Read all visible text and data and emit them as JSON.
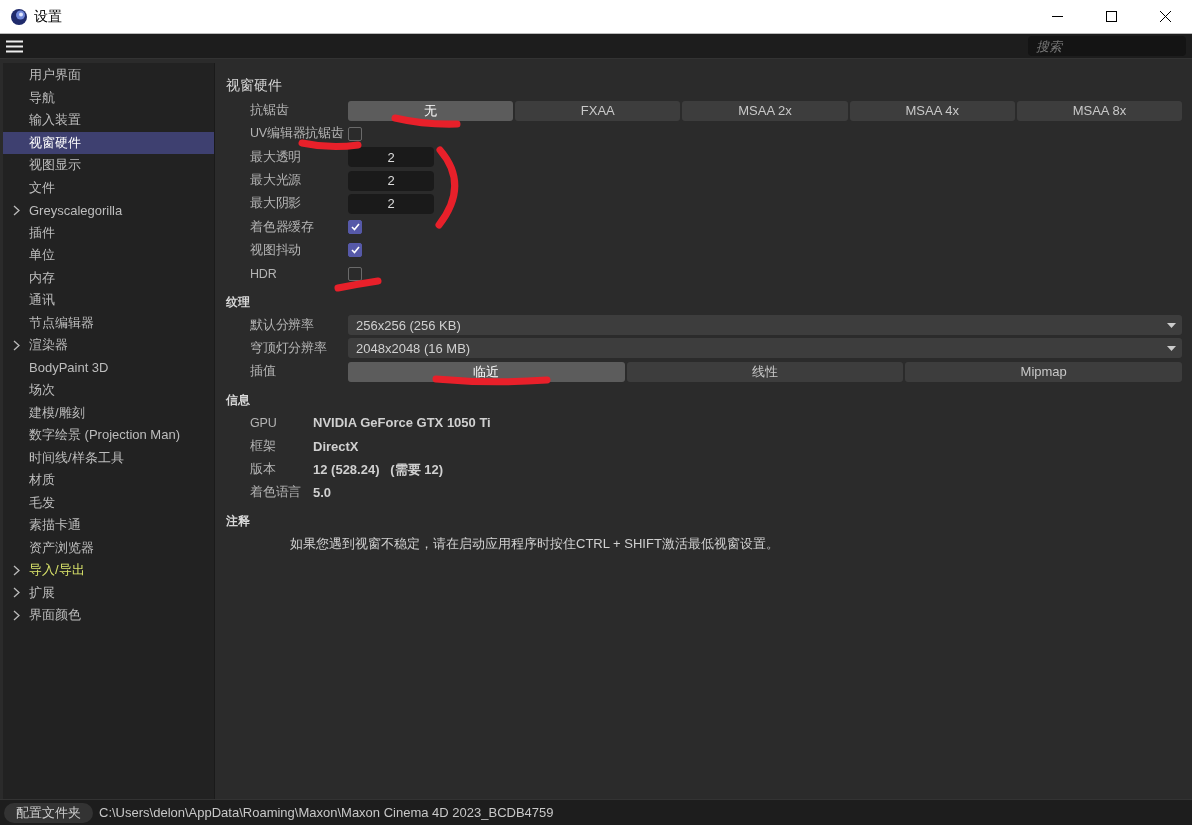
{
  "window": {
    "title": "设置"
  },
  "search": {
    "placeholder": "搜索"
  },
  "sidebar": {
    "items": [
      {
        "label": "用户界面",
        "expandable": false,
        "selected": false,
        "highlighted": false
      },
      {
        "label": "导航",
        "expandable": false,
        "selected": false,
        "highlighted": false
      },
      {
        "label": "输入装置",
        "expandable": false,
        "selected": false,
        "highlighted": false
      },
      {
        "label": "视窗硬件",
        "expandable": false,
        "selected": true,
        "highlighted": false
      },
      {
        "label": "视图显示",
        "expandable": false,
        "selected": false,
        "highlighted": false
      },
      {
        "label": "文件",
        "expandable": false,
        "selected": false,
        "highlighted": false
      },
      {
        "label": "Greyscalegorilla",
        "expandable": true,
        "selected": false,
        "highlighted": false
      },
      {
        "label": "插件",
        "expandable": false,
        "selected": false,
        "highlighted": false
      },
      {
        "label": "单位",
        "expandable": false,
        "selected": false,
        "highlighted": false
      },
      {
        "label": "内存",
        "expandable": false,
        "selected": false,
        "highlighted": false
      },
      {
        "label": "通讯",
        "expandable": false,
        "selected": false,
        "highlighted": false
      },
      {
        "label": "节点编辑器",
        "expandable": false,
        "selected": false,
        "highlighted": false
      },
      {
        "label": "渲染器",
        "expandable": true,
        "selected": false,
        "highlighted": false
      },
      {
        "label": "BodyPaint 3D",
        "expandable": false,
        "selected": false,
        "highlighted": false
      },
      {
        "label": "场次",
        "expandable": false,
        "selected": false,
        "highlighted": false
      },
      {
        "label": "建模/雕刻",
        "expandable": false,
        "selected": false,
        "highlighted": false
      },
      {
        "label": "数字绘景 (Projection Man)",
        "expandable": false,
        "selected": false,
        "highlighted": false
      },
      {
        "label": "时间线/样条工具",
        "expandable": false,
        "selected": false,
        "highlighted": false
      },
      {
        "label": "材质",
        "expandable": false,
        "selected": false,
        "highlighted": false
      },
      {
        "label": "毛发",
        "expandable": false,
        "selected": false,
        "highlighted": false
      },
      {
        "label": "素描卡通",
        "expandable": false,
        "selected": false,
        "highlighted": false
      },
      {
        "label": "资产浏览器",
        "expandable": false,
        "selected": false,
        "highlighted": false
      },
      {
        "label": "导入/导出",
        "expandable": true,
        "selected": false,
        "highlighted": true
      },
      {
        "label": "扩展",
        "expandable": true,
        "selected": false,
        "highlighted": false
      },
      {
        "label": "界面颜色",
        "expandable": true,
        "selected": false,
        "highlighted": false
      }
    ]
  },
  "sections": [
    {
      "title": "视窗硬件",
      "rows": [
        {
          "kind": "segmented",
          "label": "抗锯齿",
          "options": [
            {
              "label": "无",
              "selected": true
            },
            {
              "label": "FXAA",
              "selected": false
            },
            {
              "label": "MSAA 2x",
              "selected": false
            },
            {
              "label": "MSAA 4x",
              "selected": false
            },
            {
              "label": "MSAA 8x",
              "selected": false
            }
          ]
        },
        {
          "kind": "checkbox",
          "label": "UV编辑器抗锯齿",
          "checked": false
        },
        {
          "kind": "number",
          "label": "最大透明",
          "value": "2"
        },
        {
          "kind": "number",
          "label": "最大光源",
          "value": "2"
        },
        {
          "kind": "number",
          "label": "最大阴影",
          "value": "2"
        },
        {
          "kind": "checkbox",
          "label": "着色器缓存",
          "checked": true
        },
        {
          "kind": "checkbox",
          "label": "视图抖动",
          "checked": true
        },
        {
          "kind": "checkbox",
          "label": "HDR",
          "checked": false
        }
      ]
    },
    {
      "title": "纹理",
      "rows": [
        {
          "kind": "dropdown",
          "label": "默认分辨率",
          "value": "256x256 (256 KB)"
        },
        {
          "kind": "dropdown",
          "label": "穹顶灯分辨率",
          "value": "2048x2048 (16 MB)"
        },
        {
          "kind": "segmented",
          "label": "插值",
          "options": [
            {
              "label": "临近",
              "selected": true
            },
            {
              "label": "线性",
              "selected": false
            },
            {
              "label": "Mipmap",
              "selected": false
            }
          ]
        }
      ]
    },
    {
      "title": "信息",
      "rows": [
        {
          "kind": "info",
          "label": "GPU",
          "value": "NVIDIA GeForce GTX 1050 Ti"
        },
        {
          "kind": "info",
          "label": "框架",
          "value": "DirectX"
        },
        {
          "kind": "info",
          "label": "版本",
          "value": "12 (528.24)   (需要 12)"
        },
        {
          "kind": "info",
          "label": "着色语言",
          "value": "5.0"
        }
      ]
    },
    {
      "title": "注释",
      "rows": [
        {
          "kind": "note",
          "text": "如果您遇到视窗不稳定，请在启动应用程序时按住CTRL + SHIFT激活最低视窗设置。"
        }
      ]
    }
  ],
  "footer": {
    "button": "配置文件夹",
    "path": "C:\\Users\\delon\\AppData\\Roaming\\Maxon\\Maxon Cinema 4D 2023_BCDB4759"
  }
}
